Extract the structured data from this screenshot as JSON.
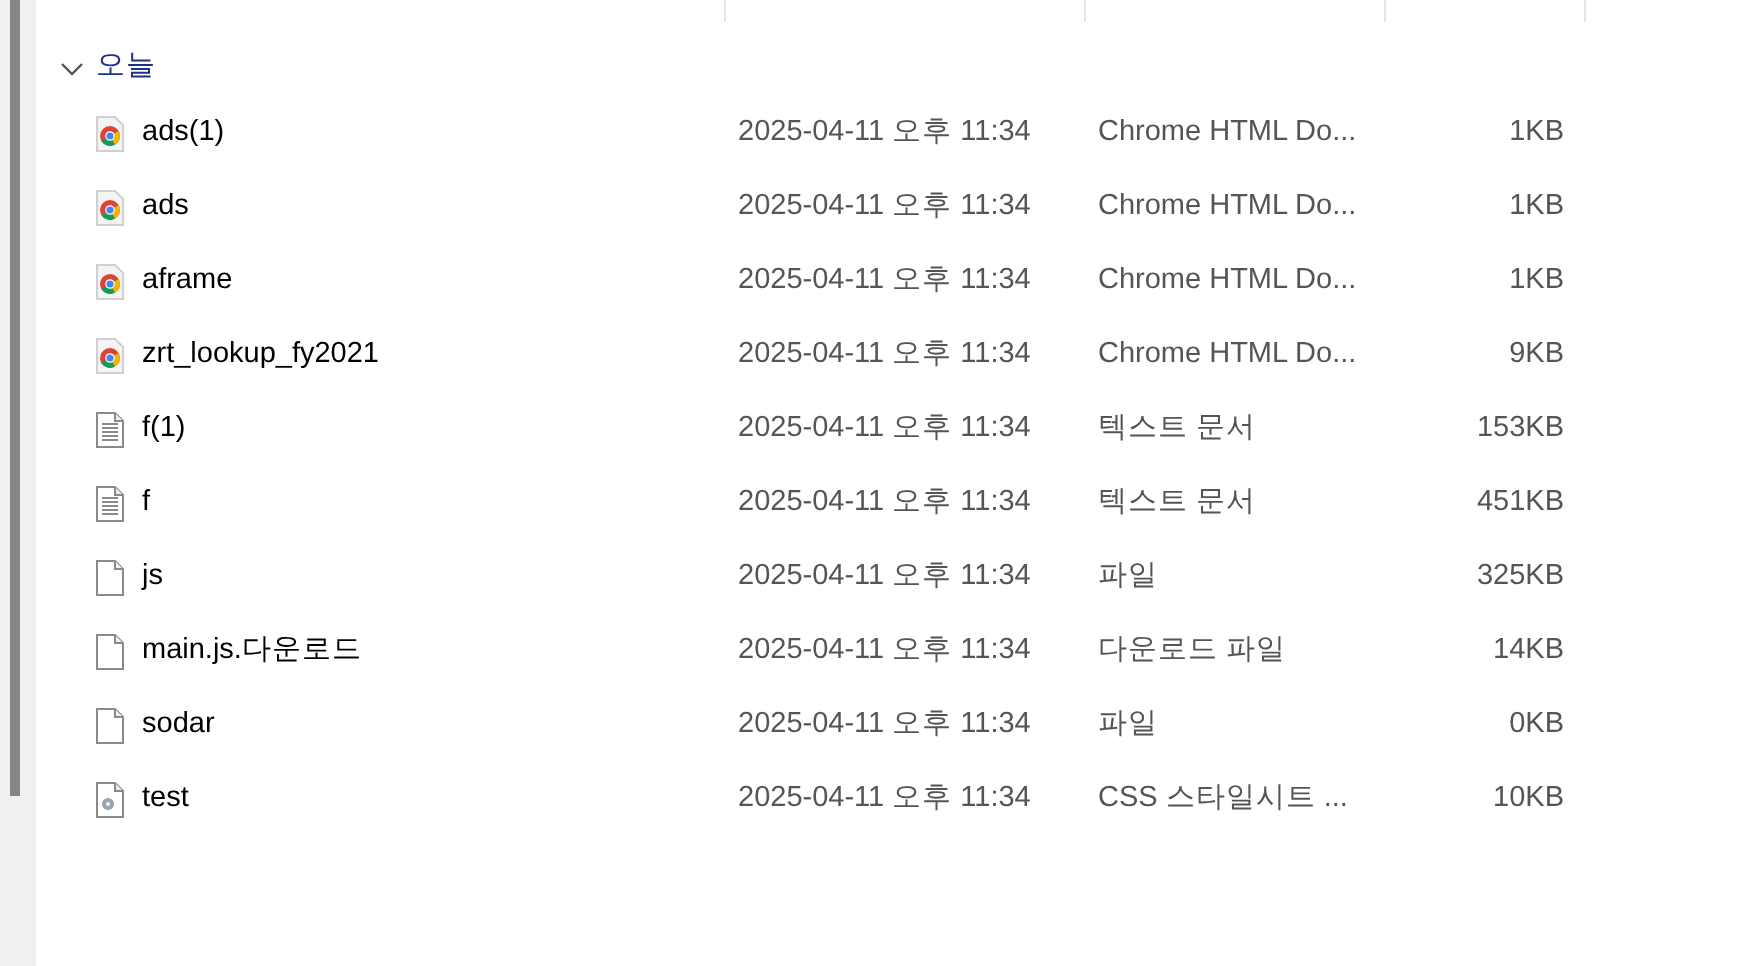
{
  "group": {
    "label": "오늘",
    "expanded": true,
    "files": [
      {
        "kind": "chrome",
        "name": "ads(1)",
        "date": "2025-04-11 오후 11:34",
        "type": "Chrome HTML Do...",
        "size": "1KB"
      },
      {
        "kind": "chrome",
        "name": "ads",
        "date": "2025-04-11 오후 11:34",
        "type": "Chrome HTML Do...",
        "size": "1KB"
      },
      {
        "kind": "chrome",
        "name": "aframe",
        "date": "2025-04-11 오후 11:34",
        "type": "Chrome HTML Do...",
        "size": "1KB"
      },
      {
        "kind": "chrome",
        "name": "zrt_lookup_fy2021",
        "date": "2025-04-11 오후 11:34",
        "type": "Chrome HTML Do...",
        "size": "9KB"
      },
      {
        "kind": "text",
        "name": "f(1)",
        "date": "2025-04-11 오후 11:34",
        "type": "텍스트 문서",
        "size": "153KB"
      },
      {
        "kind": "text",
        "name": "f",
        "date": "2025-04-11 오후 11:34",
        "type": "텍스트 문서",
        "size": "451KB"
      },
      {
        "kind": "blank",
        "name": "js",
        "date": "2025-04-11 오후 11:34",
        "type": "파일",
        "size": "325KB"
      },
      {
        "kind": "blank",
        "name": "main.js.다운로드",
        "date": "2025-04-11 오후 11:34",
        "type": "다운로드 파일",
        "size": "14KB"
      },
      {
        "kind": "blank",
        "name": "sodar",
        "date": "2025-04-11 오후 11:34",
        "type": "파일",
        "size": "0KB"
      },
      {
        "kind": "css",
        "name": "test",
        "date": "2025-04-11 오후 11:34",
        "type": "CSS 스타일시트 ...",
        "size": "10KB"
      }
    ]
  }
}
